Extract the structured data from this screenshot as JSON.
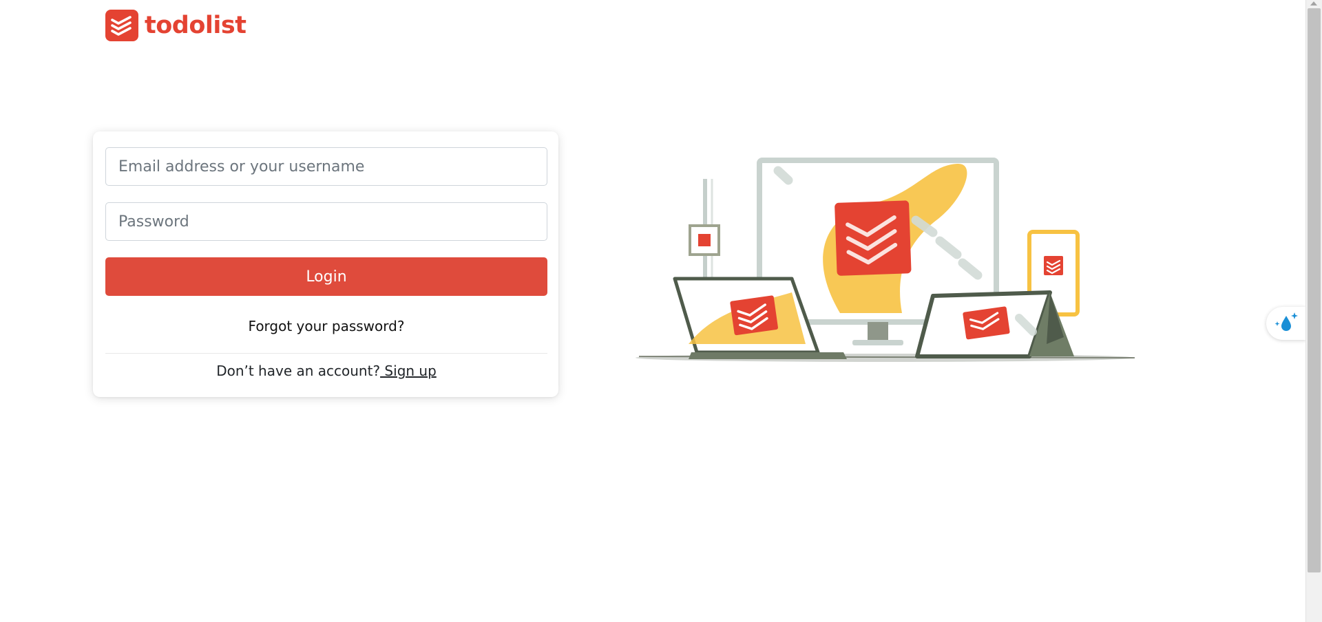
{
  "brand": {
    "name": "todolist",
    "accent_color": "#e44332",
    "logo_icon": "layered-chevrons-icon"
  },
  "login_form": {
    "email": {
      "placeholder": "Email address or your username",
      "value": ""
    },
    "password": {
      "placeholder": "Password",
      "value": ""
    },
    "submit_label": "Login",
    "submit_color": "#df4b3c",
    "forgot_label": "Forgot your password?",
    "signup_prompt": "Don’t have an account?",
    "signup_label": " Sign up"
  },
  "illustration": {
    "icon": "devices-illustration",
    "accent_colors": [
      "#e44332",
      "#f7c242",
      "#4a5a46"
    ]
  },
  "floating_helper": {
    "icon": "water-drop-sparkle-icon",
    "color": "#1a8fd6"
  }
}
